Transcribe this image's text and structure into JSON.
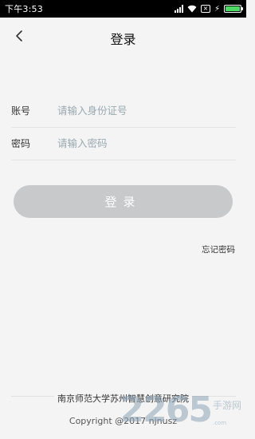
{
  "status_bar": {
    "time": "下午3:53"
  },
  "header": {
    "title": "登录",
    "back_icon": "chevron-left-icon"
  },
  "form": {
    "account_label": "账号",
    "account_placeholder": "请输入身份证号",
    "password_label": "密码",
    "password_placeholder": "请输入密码",
    "login_button": "登录",
    "forgot_password": "忘记密码"
  },
  "footer": {
    "organization": "南京师范大学苏州智慧创意研究院",
    "copyright": "Copyright @2017 njnusz"
  },
  "watermark": {
    "number": "2265",
    "text": "手游网",
    "domain": ".com"
  },
  "colors": {
    "background": "#f3f4f3",
    "button_disabled": "#c8c9ca",
    "placeholder": "#9aa9b0",
    "battery": "#4cd964"
  }
}
